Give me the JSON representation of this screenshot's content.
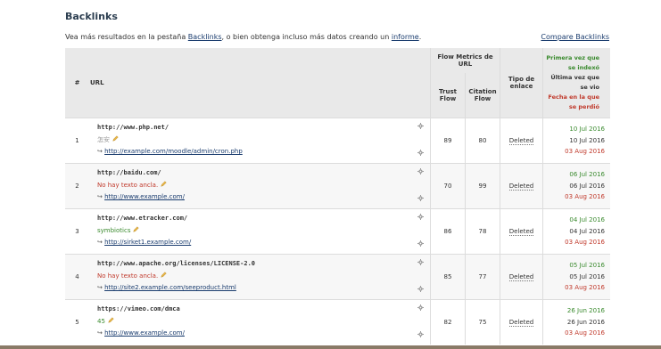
{
  "page": {
    "title": "Backlinks",
    "intro_prefix": "Vea más resultados en la pestaña ",
    "intro_link1": "Backlinks",
    "intro_middle": ", o bien obtenga incluso más datos creando un ",
    "intro_link2": "informe",
    "intro_suffix": ".",
    "compare_link": "Compare Backlinks"
  },
  "table": {
    "headers": {
      "num": "#",
      "url": "URL",
      "flow_metrics": "Flow Metrics de URL",
      "trust_flow": "Trust Flow",
      "citation_flow": "Citation Flow",
      "link_type": "Tipo de enlace",
      "first_seen": "Primera vez que se indexó",
      "last_seen": "Última vez que se vio",
      "lost_date": "Fecha en la que se perdió"
    },
    "rows": [
      {
        "num": "1",
        "url": "http://www.php.net/",
        "anchor": "怎安",
        "anchor_style": "gray",
        "source": "http://example.com/moodle/admin/cron.php",
        "trust_flow": "89",
        "citation_flow": "80",
        "type": "Deleted",
        "first_seen": "10 Jul 2016",
        "last_seen": "10 Jul 2016",
        "lost": "03 Aug 2016"
      },
      {
        "num": "2",
        "url": "http://baidu.com/",
        "anchor": "No hay texto ancla.",
        "anchor_style": "none",
        "source": "http://www.example.com/",
        "trust_flow": "70",
        "citation_flow": "99",
        "type": "Deleted",
        "first_seen": "06 Jul 2016",
        "last_seen": "06 Jul 2016",
        "lost": "03 Aug 2016"
      },
      {
        "num": "3",
        "url": "http://www.etracker.com/",
        "anchor": "symbiotics",
        "anchor_style": "ok",
        "source": "http://sirket1.example.com/",
        "trust_flow": "86",
        "citation_flow": "78",
        "type": "Deleted",
        "first_seen": "04 Jul 2016",
        "last_seen": "04 Jul 2016",
        "lost": "03 Aug 2016"
      },
      {
        "num": "4",
        "url": "http://www.apache.org/licenses/LICENSE-2.0",
        "anchor": "No hay texto ancla.",
        "anchor_style": "none",
        "source": "http://site2.example.com/seeproduct.html",
        "trust_flow": "85",
        "citation_flow": "77",
        "type": "Deleted",
        "first_seen": "05 Jul 2016",
        "last_seen": "05 Jul 2016",
        "lost": "03 Aug 2016"
      },
      {
        "num": "5",
        "url": "https://vimeo.com/dmca",
        "anchor": "45",
        "anchor_style": "ok",
        "source": "http://www.example.com/",
        "trust_flow": "82",
        "citation_flow": "75",
        "type": "Deleted",
        "first_seen": "26 Jun 2016",
        "last_seen": "26 Jun 2016",
        "lost": "03 Aug 2016"
      }
    ]
  },
  "colors": {
    "first_seen": "#3a8a2e",
    "last_seen": "#333333",
    "lost": "#c0392b",
    "link": "#1a3c6e"
  },
  "icons": {
    "source_arrow": "↪",
    "row_icons": [
      "gear-icon",
      "pencil-icon"
    ]
  }
}
